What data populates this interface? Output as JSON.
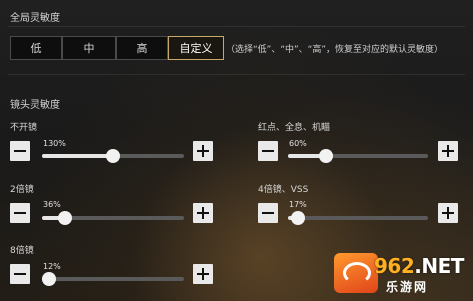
{
  "global_section": {
    "title": "全局灵敏度",
    "presets": [
      {
        "label": "低",
        "active": false
      },
      {
        "label": "中",
        "active": false
      },
      {
        "label": "高",
        "active": false
      },
      {
        "label": "自定义",
        "active": true
      }
    ],
    "hint": "（选择“低”、“中”、“高”，恢复至对应的默认灵敏度）"
  },
  "scope_section": {
    "title": "镜头灵敏度",
    "sliders": [
      {
        "label": "不开镜",
        "value_text": "130%",
        "level": 0.5
      },
      {
        "label": "红点、全息、机瞄",
        "value_text": "60%",
        "level": 0.27
      },
      {
        "label": "2倍镜",
        "value_text": "36%",
        "level": 0.16
      },
      {
        "label": "4倍镜、VSS",
        "value_text": "17%",
        "level": 0.07
      },
      {
        "label": "8倍镜",
        "value_text": "12%",
        "level": 0.05
      }
    ]
  },
  "watermark": {
    "brand": "962.NET",
    "brand_num": "962",
    "brand_suffix": ".NET",
    "site": "乐游网"
  },
  "colors": {
    "active_border": "#c8a96a",
    "track": "#5a5a5a",
    "fill": "#e6e6e6"
  }
}
